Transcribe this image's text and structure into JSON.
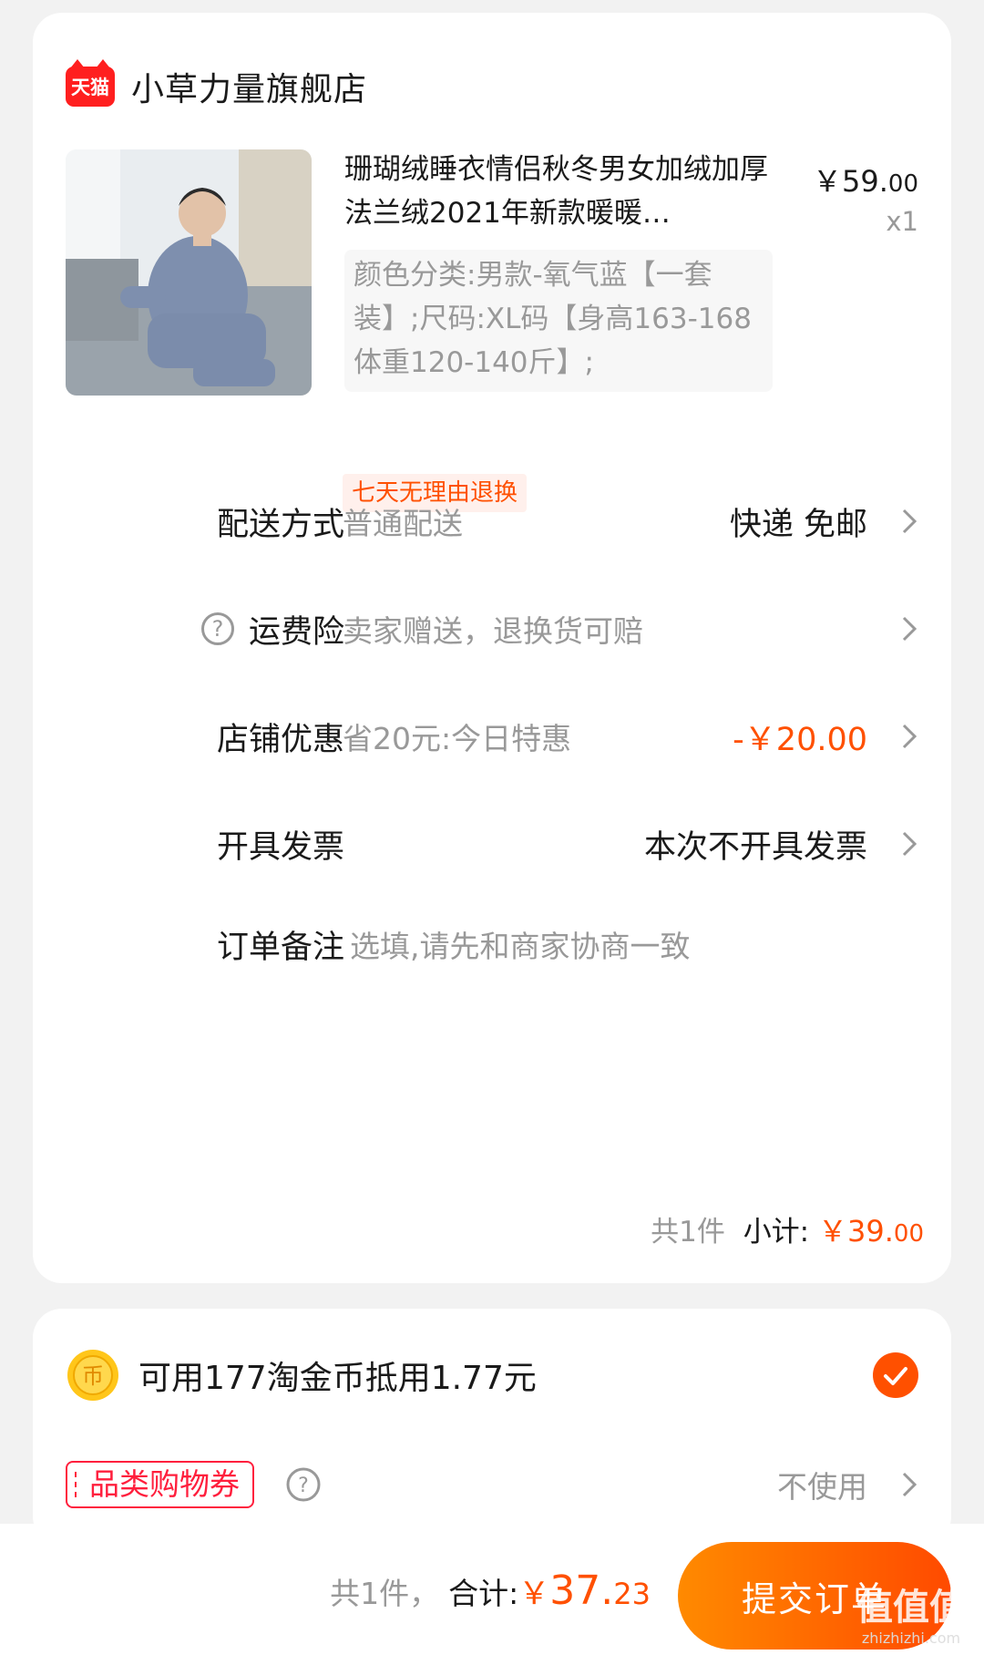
{
  "store": {
    "badge": "天猫",
    "name": "小草力量旗舰店"
  },
  "product": {
    "title": "珊瑚绒睡衣情侣秋冬男女加绒加厚法兰绒2021年新款暖暖…",
    "price_main": "￥59.",
    "price_cents": "00",
    "quantity": "x1",
    "sku": "颜色分类:男款-氧气蓝【一套装】;尺码:XL码【身高163-168 体重120-140斤】;",
    "return_tag": "七天无理由退换"
  },
  "rows": {
    "shipping": {
      "label": "配送方式",
      "desc": "普通配送",
      "value": "快递 免邮"
    },
    "insurance": {
      "label": "运费险",
      "desc": "卖家赠送，退换货可赔"
    },
    "discount": {
      "label": "店铺优惠",
      "desc": "省20元:今日特惠",
      "value": "-￥20.00"
    },
    "invoice": {
      "label": "开具发票",
      "value": "本次不开具发票"
    },
    "note": {
      "label": "订单备注",
      "placeholder": "选填,请先和商家协商一致"
    }
  },
  "subtotal": {
    "count": "共1件",
    "label": "小计:",
    "amount_main": "￥39.",
    "amount_cents": "00"
  },
  "coins": {
    "text": "可用177淘金币抵用1.77元",
    "checked": true
  },
  "coupon": {
    "tag": "品类购物券",
    "value": "不使用"
  },
  "footer": {
    "count": "共1件，",
    "label": "合计:",
    "currency": "￥",
    "amount_main": "37.",
    "amount_cents": "23",
    "submit": "提交订单"
  },
  "watermark": {
    "text": "值值值",
    "url": "zhizhizhi.com"
  },
  "colors": {
    "accent": "#ff5000",
    "tmall_red": "#ff1f1f",
    "muted": "#999999"
  }
}
